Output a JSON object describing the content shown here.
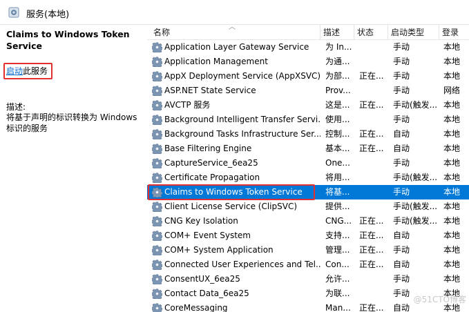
{
  "window": {
    "title": "服务(本地)",
    "title_icon": "services-gear-icon"
  },
  "left_pane": {
    "service_name": "Claims to Windows Token Service",
    "start_link": "启动",
    "start_suffix": "此服务",
    "description_label": "描述:",
    "description": "将基于声明的标识转换为 Windows 标识的服务"
  },
  "columns": {
    "name": "名称",
    "description": "描述",
    "status": "状态",
    "startup": "启动类型",
    "logon": "登录"
  },
  "services": [
    {
      "name": "Application Layer Gateway Service",
      "desc": "为 In...",
      "status": "",
      "startup": "手动",
      "logon": "本地"
    },
    {
      "name": "Application Management",
      "desc": "为通...",
      "status": "",
      "startup": "手动",
      "logon": "本地"
    },
    {
      "name": "AppX Deployment Service (AppXSVC)",
      "desc": "为部...",
      "status": "正在...",
      "startup": "手动",
      "logon": "本地"
    },
    {
      "name": "ASP.NET State Service",
      "desc": "Prov...",
      "status": "",
      "startup": "手动",
      "logon": "网络"
    },
    {
      "name": "AVCTP 服务",
      "desc": "这是...",
      "status": "正在...",
      "startup": "手动(触发...",
      "logon": "本地"
    },
    {
      "name": "Background Intelligent Transfer Servi...",
      "desc": "使用...",
      "status": "",
      "startup": "手动",
      "logon": "本地"
    },
    {
      "name": "Background Tasks Infrastructure Ser...",
      "desc": "控制...",
      "status": "正在...",
      "startup": "自动",
      "logon": "本地"
    },
    {
      "name": "Base Filtering Engine",
      "desc": "基本...",
      "status": "正在...",
      "startup": "自动",
      "logon": "本地"
    },
    {
      "name": "CaptureService_6ea25",
      "desc": "One...",
      "status": "",
      "startup": "手动",
      "logon": "本地"
    },
    {
      "name": "Certificate Propagation",
      "desc": "将用...",
      "status": "",
      "startup": "手动(触发...",
      "logon": "本地"
    },
    {
      "name": "Claims to Windows Token Service",
      "desc": "将基...",
      "status": "",
      "startup": "手动",
      "logon": "本地"
    },
    {
      "name": "Client License Service (ClipSVC)",
      "desc": "提供...",
      "status": "",
      "startup": "手动(触发...",
      "logon": "本地"
    },
    {
      "name": "CNG Key Isolation",
      "desc": "CNG...",
      "status": "正在...",
      "startup": "手动(触发...",
      "logon": "本地"
    },
    {
      "name": "COM+ Event System",
      "desc": "支持...",
      "status": "正在...",
      "startup": "自动",
      "logon": "本地"
    },
    {
      "name": "COM+ System Application",
      "desc": "管理...",
      "status": "正在...",
      "startup": "手动",
      "logon": "本地"
    },
    {
      "name": "Connected User Experiences and Tel...",
      "desc": "Con...",
      "status": "正在...",
      "startup": "自动",
      "logon": "本地"
    },
    {
      "name": "ConsentUX_6ea25",
      "desc": "允许...",
      "status": "",
      "startup": "手动",
      "logon": "本地"
    },
    {
      "name": "Contact Data_6ea25",
      "desc": "为联...",
      "status": "",
      "startup": "手动",
      "logon": "本地"
    },
    {
      "name": "CoreMessaging",
      "desc": "Man...",
      "status": "正在...",
      "startup": "自动",
      "logon": "本地"
    }
  ],
  "selected_index": 10,
  "watermark": "@51CTO博客",
  "colors": {
    "selection": "#0078d7",
    "highlight_box": "#e23030",
    "link": "#0066cc"
  }
}
